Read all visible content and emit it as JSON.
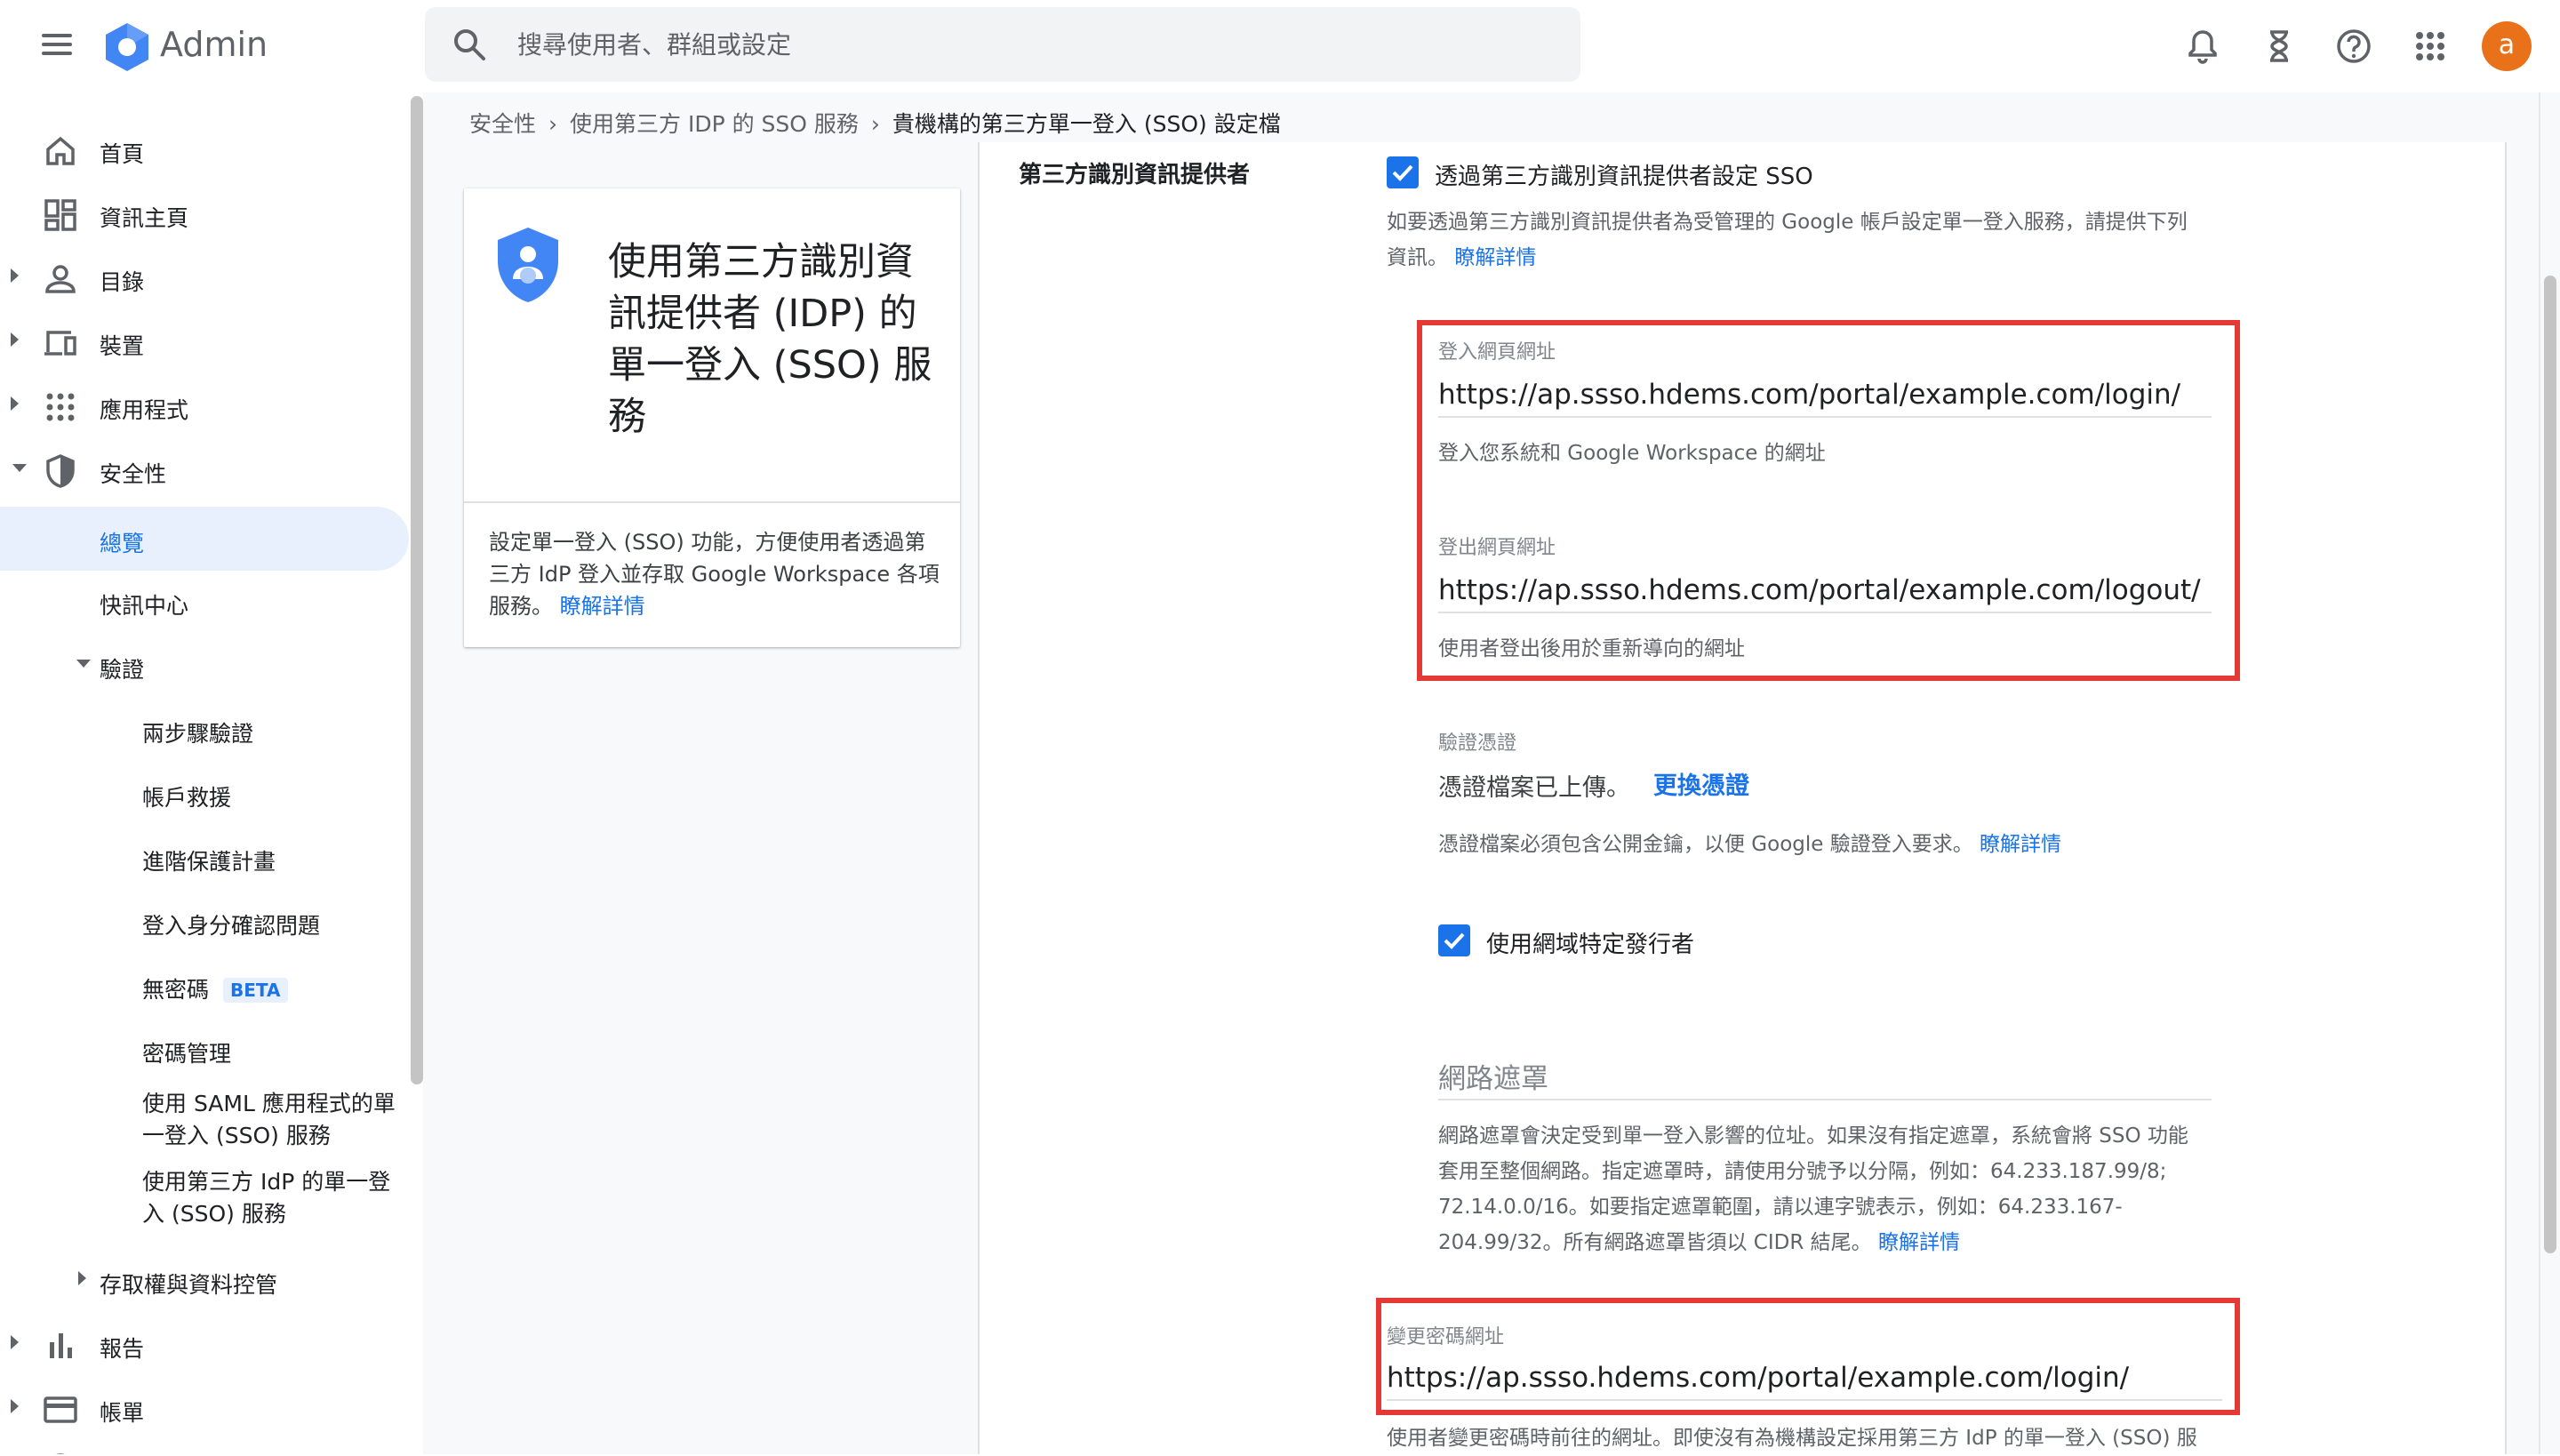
{
  "app": {
    "title": "Admin"
  },
  "search": {
    "placeholder": "搜尋使用者、群組或設定"
  },
  "topbar": {
    "avatar_letter": "a"
  },
  "sidebar": {
    "items": [
      {
        "label": "首頁"
      },
      {
        "label": "資訊主頁"
      },
      {
        "label": "目錄"
      },
      {
        "label": "裝置"
      },
      {
        "label": "應用程式"
      },
      {
        "label": "安全性"
      },
      {
        "label": "總覽"
      },
      {
        "label": "快訊中心"
      },
      {
        "label": "驗證"
      },
      {
        "label": "兩步驟驗證"
      },
      {
        "label": "帳戶救援"
      },
      {
        "label": "進階保護計畫"
      },
      {
        "label": "登入身分確認問題"
      },
      {
        "label": "無密碼",
        "badge": "BETA"
      },
      {
        "label": "密碼管理"
      },
      {
        "label": "使用 SAML 應用程式的單一登入 (SSO) 服務"
      },
      {
        "label": "使用第三方 IdP 的單一登入 (SSO) 服務"
      },
      {
        "label": "存取權與資料控管"
      },
      {
        "label": "報告"
      },
      {
        "label": "帳單"
      },
      {
        "label": "帳戶"
      }
    ]
  },
  "breadcrumb": {
    "items": [
      "安全性",
      "使用第三方 IDP 的 SSO 服務",
      "貴機構的第三方單一登入 (SSO) 設定檔"
    ]
  },
  "card": {
    "title": "使用第三方識別資訊提供者 (IDP) 的單一登入 (SSO) 服務",
    "description": "設定單一登入 (SSO) 功能，方便使用者透過第三方 IdP 登入並存取 Google Workspace 各項服務。",
    "learn_more": "瞭解詳情"
  },
  "settings": {
    "section_label": "第三方識別資訊提供者",
    "sso_checkbox_label": "透過第三方識別資訊提供者設定 SSO",
    "sso_help_line1": "如要透過第三方識別資訊提供者為受管理的 Google 帳戶設定單一登入服務，請提供下列",
    "sso_help_line2": "資訊。",
    "learn_more": "瞭解詳情",
    "login_url_label": "登入網頁網址",
    "login_url_value": "https://ap.ssso.hdems.com/portal/example.com/login/",
    "login_url_help": "登入您系統和 Google Workspace 的網址",
    "logout_url_label": "登出網頁網址",
    "logout_url_value": "https://ap.ssso.hdems.com/portal/example.com/logout/",
    "logout_url_help": "使用者登出後用於重新導向的網址",
    "cert_label": "驗證憑證",
    "cert_status": "憑證檔案已上傳。",
    "cert_replace": "更換憑證",
    "cert_help": "憑證檔案必須包含公開金鑰，以便 Google 驗證登入要求。",
    "domain_issuer_label": "使用網域特定發行者",
    "netmask_title": "網路遮罩",
    "netmask_help_line1": "網路遮罩會決定受到單一登入影響的位址。如果沒有指定遮罩，系統會將 SSO 功能",
    "netmask_help_line2": "套用至整個網路。指定遮罩時，請使用分號予以分隔，例如：64.233.187.99/8;",
    "netmask_help_line3": "72.14.0.0/16。如要指定遮罩範圍，請以連字號表示，例如：64.233.167-",
    "netmask_help_line4": "204.99/32。所有網路遮罩皆須以 CIDR 結尾。",
    "change_pw_label": "變更密碼網址",
    "change_pw_value": "https://ap.ssso.hdems.com/portal/example.com/login/",
    "change_pw_help": "使用者變更密碼時前往的網址。即使沒有為機構設定採用第三方 IdP 的單一登入 (SSO) 服"
  },
  "colors": {
    "accent": "#1a73e8",
    "highlight_box": "#e53935",
    "avatar": "#e8711a"
  }
}
